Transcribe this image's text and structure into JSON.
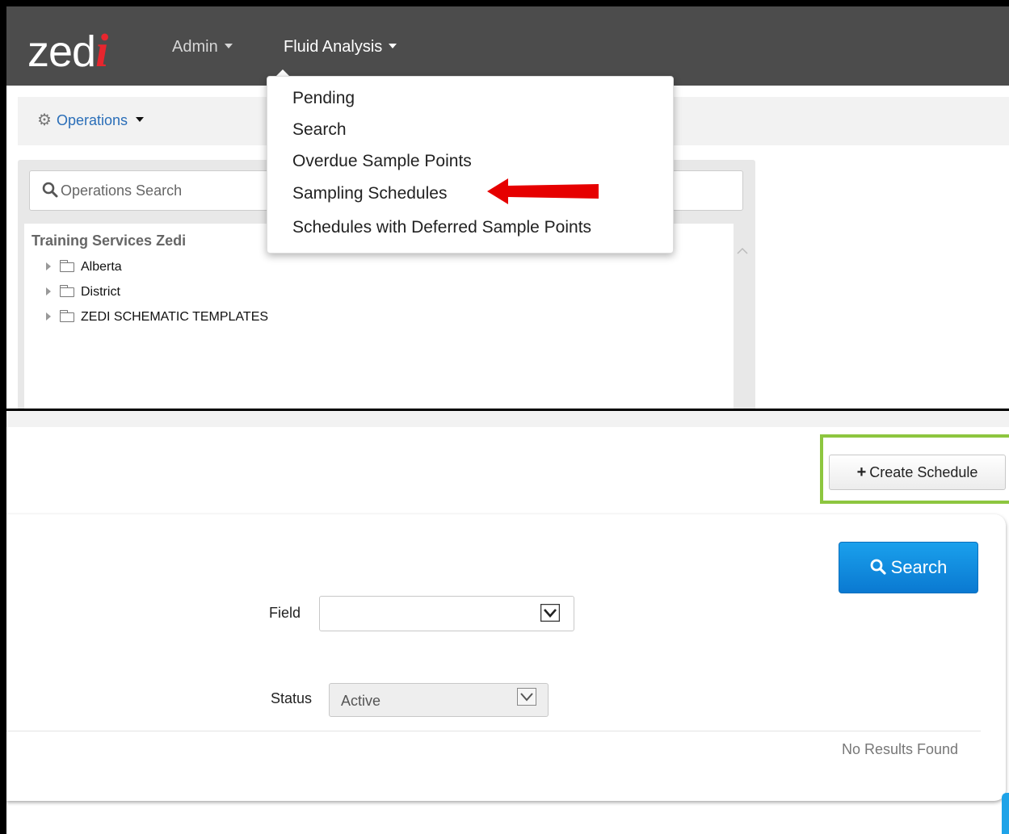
{
  "navbar": {
    "logo_text": "zed",
    "logo_accent": "i",
    "logo_accent_color": "#e8262e",
    "items": [
      {
        "label": "Admin"
      },
      {
        "label": "Fluid Analysis"
      }
    ]
  },
  "operations": {
    "toggle_label": "Operations",
    "search_placeholder": "Operations Search",
    "tree": {
      "root": "Training Services Zedi",
      "items": [
        {
          "label": "Alberta"
        },
        {
          "label": "District"
        },
        {
          "label": "ZEDI SCHEMATIC TEMPLATES"
        }
      ]
    }
  },
  "fluid_menu": {
    "items": [
      {
        "label": "Pending"
      },
      {
        "label": "Search"
      },
      {
        "label": "Overdue Sample Points"
      },
      {
        "label": "Sampling Schedules",
        "highlighted_by_arrow": true
      },
      {
        "label": "Schedules with Deferred Sample Points"
      }
    ],
    "arrow_color": "#e60000"
  },
  "schedules": {
    "create_button_label": "Create Schedule",
    "highlight_color": "#8dc63f",
    "search_button_label": "Search",
    "search_button_color": "#1592e0",
    "field_label": "Field",
    "field_value": "",
    "status_label": "Status",
    "status_value": "Active",
    "no_results_text": "No Results Found"
  }
}
